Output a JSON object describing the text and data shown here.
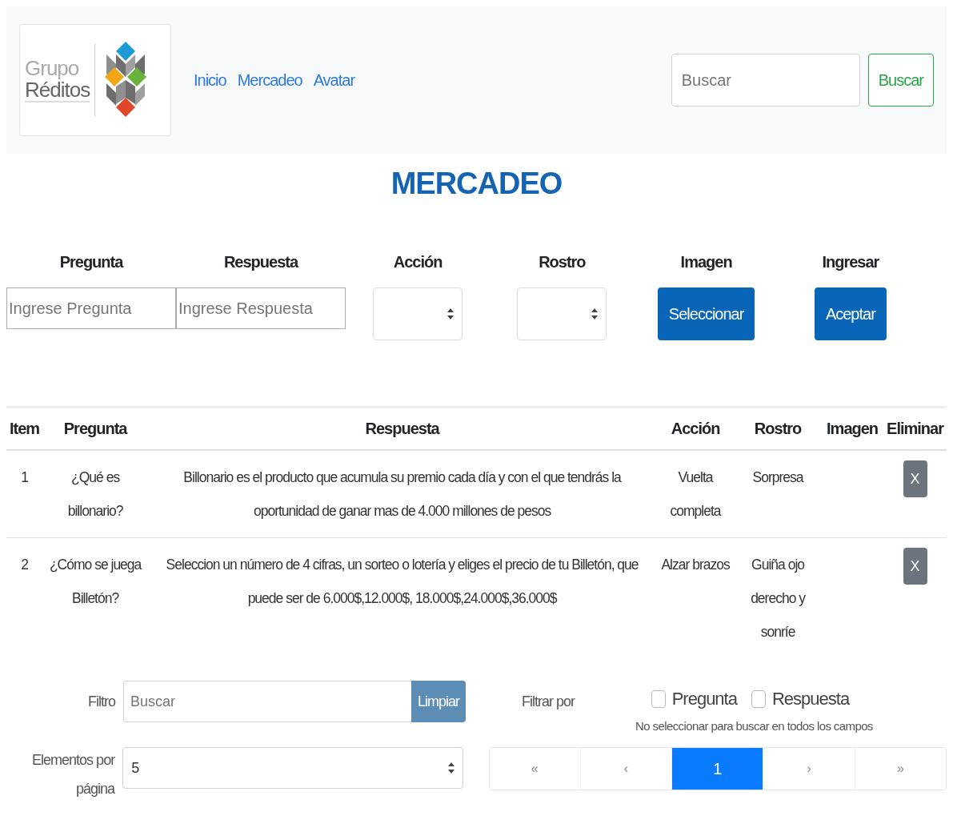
{
  "navbar": {
    "logo": {
      "line1": "Grupo",
      "line2": "Réditos"
    },
    "links": [
      "Inicio",
      "Mercadeo",
      "Avatar"
    ],
    "search": {
      "placeholder": "Buscar"
    },
    "search_button": "Buscar"
  },
  "title": "MERCADEO",
  "form": {
    "fields": [
      {
        "label": "Pregunta",
        "kind": "input",
        "placeholder": "Ingrese Pregunta"
      },
      {
        "label": "Respuesta",
        "kind": "input",
        "placeholder": "Ingrese Respuesta"
      },
      {
        "label": "Acción",
        "kind": "select"
      },
      {
        "label": "Rostro",
        "kind": "select"
      },
      {
        "label": "Imagen",
        "kind": "button",
        "button": "Seleccionar"
      },
      {
        "label": "Ingresar",
        "kind": "button",
        "button": "Aceptar"
      }
    ]
  },
  "table": {
    "columns": [
      "Item",
      "Pregunta",
      "Respuesta",
      "Acción",
      "Rostro",
      "Imagen",
      "Eliminar"
    ],
    "rows": [
      {
        "item": "1",
        "pregunta": "¿Qué es billonario?",
        "respuesta": "Billonario es el producto que acumula su premio cada día y con el que tendrás la oportunidad de ganar mas de 4.000 millones de pesos",
        "accion": "Vuelta completa",
        "rostro": "Sorpresa",
        "delete": "X"
      },
      {
        "item": "2",
        "pregunta": "¿Cómo se juega Billetón?",
        "respuesta": "Seleccion un número de 4 cifras, un sorteo o lotería y eliges el precio de tu Billetón, que puede ser de 6.000$,12.000$, 18.000$,24.000$,36.000$",
        "accion": "Alzar brazos",
        "rostro": "Guiña ojo derecho y sonríe",
        "delete": "X"
      }
    ]
  },
  "filter": {
    "label": "Filtro",
    "placeholder": "Buscar",
    "clear_button": "Limpiar",
    "filter_by_label": "Filtrar por",
    "options": [
      {
        "label": "Pregunta",
        "checked": false
      },
      {
        "label": "Respuesta",
        "checked": false
      }
    ],
    "hint": "No seleccionar para buscar en todos los campos",
    "per_page_label": "Elementos por página",
    "per_page_value": "5",
    "pagination": [
      {
        "label": "«",
        "selected": false
      },
      {
        "label": "‹",
        "selected": false
      },
      {
        "label": "1",
        "selected": true
      },
      {
        "label": "›",
        "selected": false
      },
      {
        "label": "»",
        "selected": false
      }
    ]
  }
}
